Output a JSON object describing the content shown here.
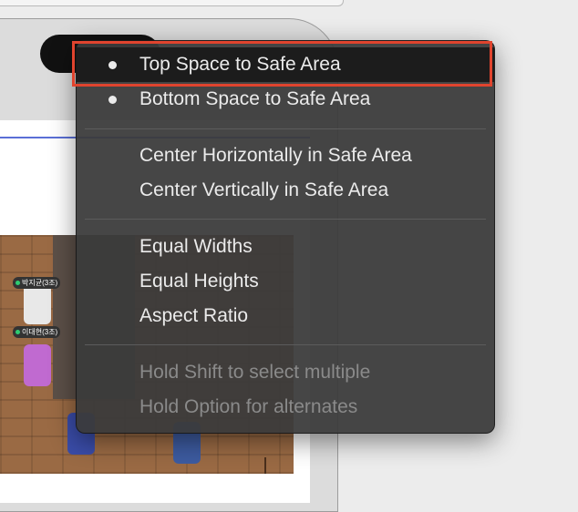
{
  "menu": {
    "items": [
      {
        "label": "Top Space to Safe Area",
        "bullet": true,
        "enabled": true,
        "highlighted": true
      },
      {
        "label": "Bottom Space to Safe Area",
        "bullet": true,
        "enabled": true,
        "highlighted": false
      },
      {
        "label": "Center Horizontally in Safe Area",
        "bullet": false,
        "enabled": true,
        "highlighted": false
      },
      {
        "label": "Center Vertically in Safe Area",
        "bullet": false,
        "enabled": true,
        "highlighted": false
      },
      {
        "label": "Equal Widths",
        "bullet": false,
        "enabled": true,
        "highlighted": false
      },
      {
        "label": "Equal Heights",
        "bullet": false,
        "enabled": true,
        "highlighted": false
      },
      {
        "label": "Aspect Ratio",
        "bullet": false,
        "enabled": true,
        "highlighted": false
      },
      {
        "label": "Hold Shift to select multiple",
        "bullet": false,
        "enabled": false,
        "highlighted": false
      },
      {
        "label": "Hold Option for alternates",
        "bullet": false,
        "enabled": false,
        "highlighted": false
      }
    ]
  },
  "scene": {
    "name_tags": [
      "박지균(3조)",
      "이대현(3조)"
    ]
  },
  "colors": {
    "menu_background": "#3a3a3a",
    "highlight_outline": "#e0442e",
    "highlighted_row": "#1c1c1c",
    "disabled_text": "#8a8a8a"
  }
}
